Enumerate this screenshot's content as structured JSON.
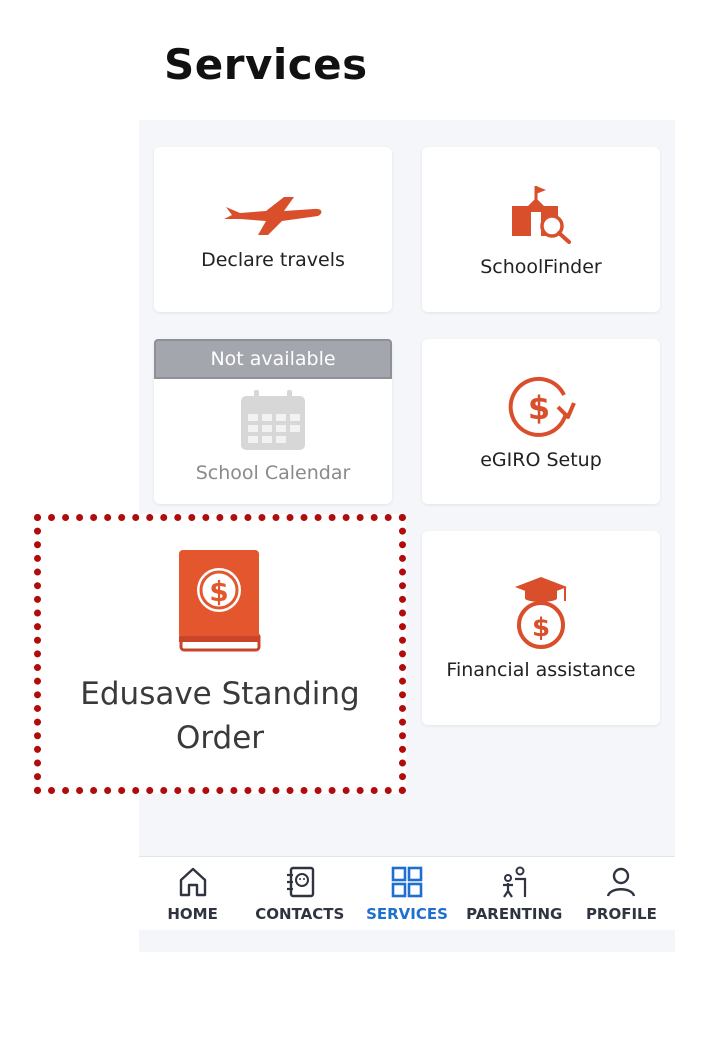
{
  "page": {
    "title": "Services"
  },
  "colors": {
    "accent": "#d94f2b",
    "active_tab": "#1f6fd1",
    "callout_border": "#b00c0c",
    "banner": "#a3a6ad"
  },
  "services": [
    {
      "label": "Declare travels",
      "icon": "airplane-icon",
      "available": true
    },
    {
      "label": "SchoolFinder",
      "icon": "school-search-icon",
      "available": true
    },
    {
      "label": "School Calendar",
      "icon": "calendar-icon",
      "available": false,
      "badge": "Not available"
    },
    {
      "label": "eGIRO Setup",
      "icon": "dollar-refresh-icon",
      "available": true
    },
    {
      "label": "Financial assistance",
      "icon": "money-bag-graduation-icon",
      "available": true
    }
  ],
  "highlight": {
    "label": "Edusave Standing Order",
    "icon": "dollar-book-icon"
  },
  "tabbar": {
    "tabs": [
      {
        "label": "HOME",
        "icon": "home-icon",
        "active": false
      },
      {
        "label": "CONTACTS",
        "icon": "contacts-book-icon",
        "active": false
      },
      {
        "label": "SERVICES",
        "icon": "grid-icon",
        "active": true
      },
      {
        "label": "PARENTING",
        "icon": "parent-child-icon",
        "active": false
      },
      {
        "label": "PROFILE",
        "icon": "person-icon",
        "active": false
      }
    ]
  }
}
